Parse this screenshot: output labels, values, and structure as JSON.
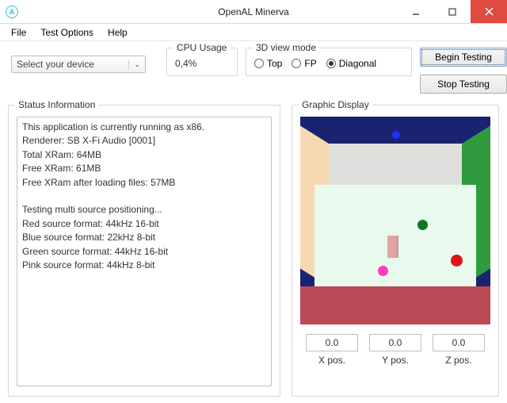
{
  "window": {
    "title": "OpenAL Minerva"
  },
  "menu": {
    "file": "File",
    "test_options": "Test Options",
    "help": "Help"
  },
  "device": {
    "placeholder": "Select your device"
  },
  "cpu": {
    "legend": "CPU Usage",
    "value": "0,4%"
  },
  "viewmode": {
    "legend": "3D view mode",
    "options": {
      "top": "Top",
      "fp": "FP",
      "diagonal": "Diagonal"
    },
    "selected": "diagonal"
  },
  "buttons": {
    "begin": "Begin Testing",
    "stop": "Stop Testing"
  },
  "status": {
    "legend": "Status Information",
    "text": "This application is currently running as x86.\nRenderer: SB X-Fi Audio [0001]\nTotal XRam: 64MB\nFree XRam: 61MB\nFree XRam after loading files: 57MB\n\nTesting multi source positioning...\nRed source format: 44kHz 16-bit\nBlue source format: 22kHz 8-bit\nGreen source format: 44kHz 16-bit\nPink source format: 44kHz 8-bit"
  },
  "graphic": {
    "legend": "Graphic Display",
    "positions": {
      "x": {
        "value": "0.0",
        "label": "X pos."
      },
      "y": {
        "value": "0.0",
        "label": "Y pos."
      },
      "z": {
        "value": "0.0",
        "label": "Z pos."
      }
    }
  }
}
